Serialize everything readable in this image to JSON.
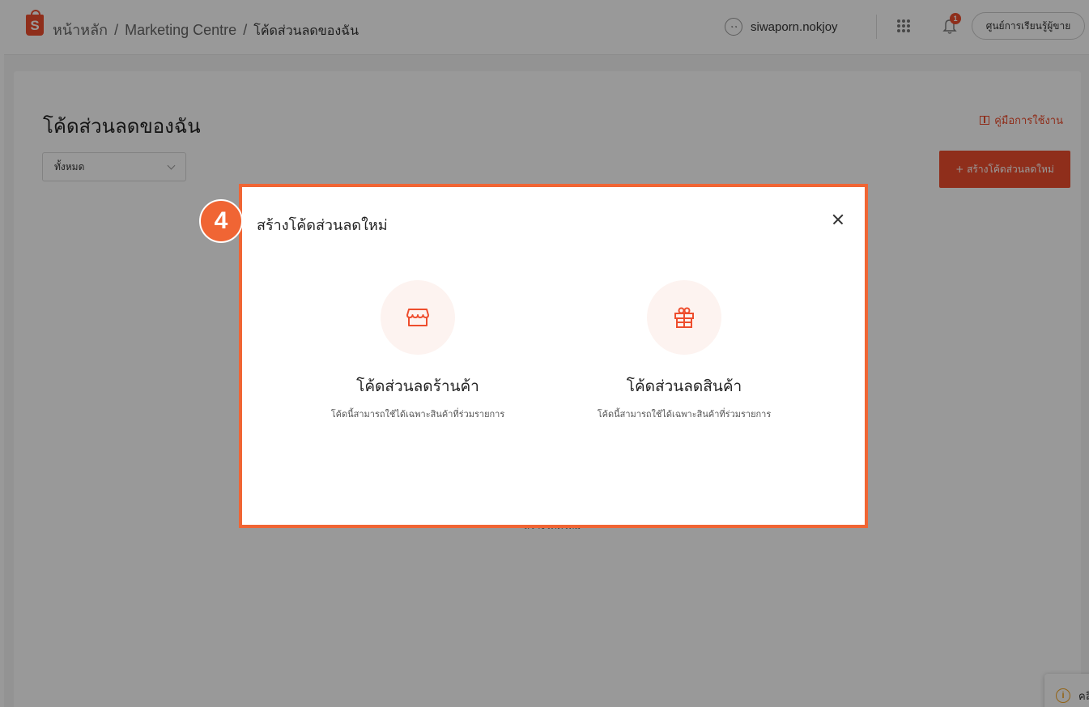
{
  "header": {
    "logo_letter": "S",
    "breadcrumb": {
      "home": "หน้าหลัก",
      "separator": "/",
      "marketing": "Marketing Centre",
      "current": "โค้ดส่วนลดของฉัน"
    },
    "username": "siwaporn.nokjoy",
    "notification_count": "1",
    "learning_center_label": "ศูนย์การเรียนรู้ผู้ขาย"
  },
  "page": {
    "title": "โค้ดส่วนลดของฉัน",
    "guide_link": "คู่มือการใช้งาน",
    "filter_value": "ทั้งหมด",
    "create_button": "+ สร้างโค้ดส่วนลดใหม่",
    "background_text": "สร้างโค้ดใหม่",
    "toast_text": "คลิก"
  },
  "modal": {
    "step_number": "4",
    "title": "สร้างโค้ดส่วนลดใหม่",
    "options": [
      {
        "icon": "shop-icon",
        "title": "โค้ดส่วนลดร้านค้า",
        "description": "โค้ดนี้สามารถใช้ได้เฉพาะสินค้าที่ร่วมรายการ"
      },
      {
        "icon": "gift-icon",
        "title": "โค้ดส่วนลดสินค้า",
        "description": "โค้ดนี้สามารถใช้ได้เฉพาะสินค้าที่ร่วมรายการ"
      }
    ]
  },
  "colors": {
    "brand": "#ee4d2d",
    "highlight": "#f06534",
    "icon_bg": "#fdf3f0"
  }
}
